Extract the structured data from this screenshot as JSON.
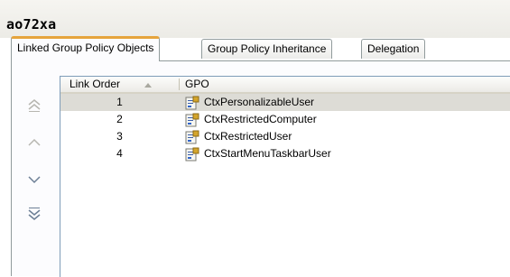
{
  "window": {
    "title": "ao72xa"
  },
  "tabs": [
    {
      "label": "Linked Group Policy Objects",
      "active": true
    },
    {
      "label": "Group Policy Inheritance",
      "active": false
    },
    {
      "label": "Delegation",
      "active": false
    }
  ],
  "columns": {
    "link_order": "Link Order",
    "gpo": "GPO",
    "sort": "ascending"
  },
  "rows": [
    {
      "order": "1",
      "gpo": "CtxPersonalizableUser",
      "selected": true
    },
    {
      "order": "2",
      "gpo": "CtxRestrictedComputer",
      "selected": false
    },
    {
      "order": "3",
      "gpo": "CtxRestrictedUser",
      "selected": false
    },
    {
      "order": "4",
      "gpo": "CtxStartMenuTaskbarUser",
      "selected": false
    }
  ],
  "icons": {
    "move_top": "double-up-arrow-icon",
    "move_up": "up-arrow-icon",
    "move_down": "down-arrow-icon",
    "move_bottom": "double-down-arrow-icon",
    "row_icon": "gpo-script-icon",
    "sort": "sort-ascending-icon"
  },
  "colors": {
    "active_tab_accent": "#e6a43c",
    "selected_row": "#dddcd6",
    "border": "#919b9c"
  }
}
